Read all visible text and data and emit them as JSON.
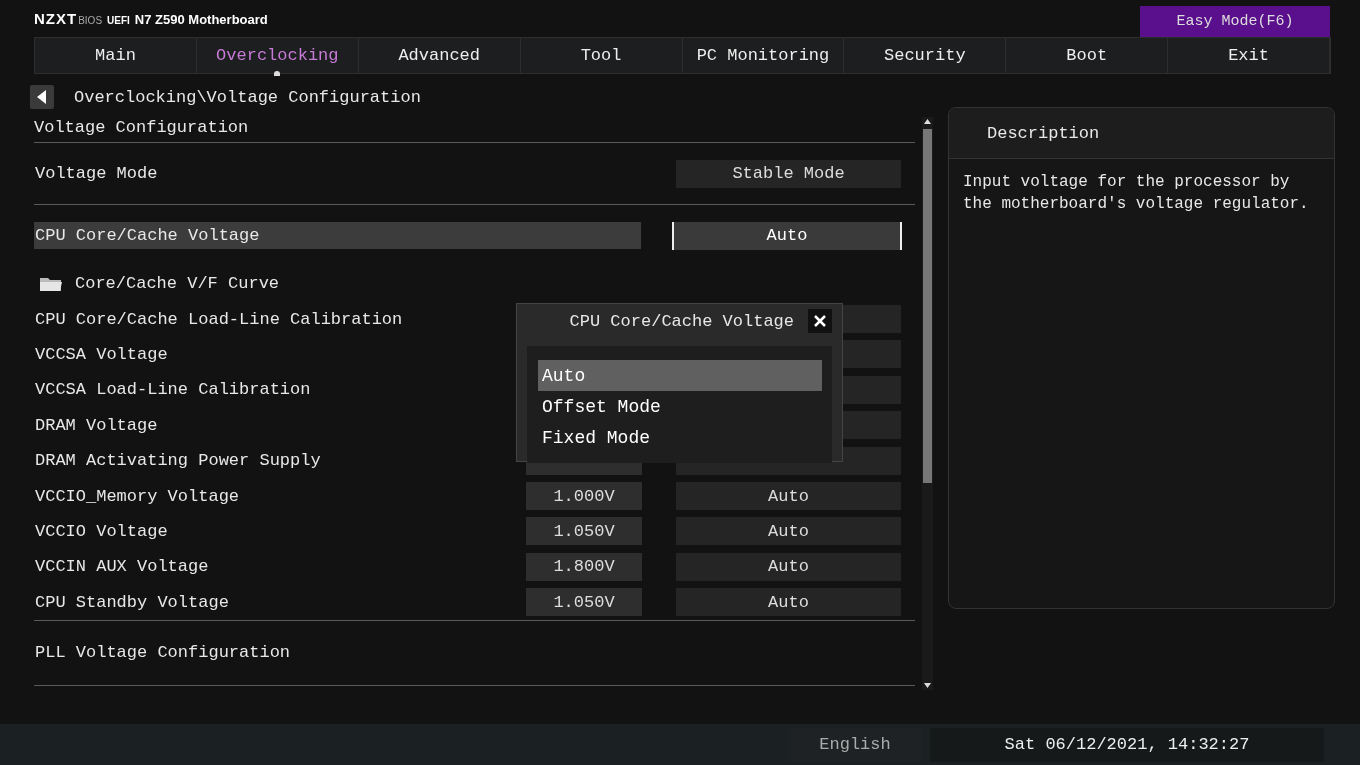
{
  "header": {
    "brand": "NZXT",
    "bios": "BIOS",
    "uefi": "UEFI",
    "model": "N7 Z590 Motherboard",
    "easy_mode": "Easy Mode(F6)"
  },
  "tabs": [
    {
      "label": "Main",
      "selected": false
    },
    {
      "label": "Overclocking",
      "selected": true
    },
    {
      "label": "Advanced",
      "selected": false
    },
    {
      "label": "Tool",
      "selected": false
    },
    {
      "label": "PC Monitoring",
      "selected": false
    },
    {
      "label": "Security",
      "selected": false
    },
    {
      "label": "Boot",
      "selected": false
    },
    {
      "label": "Exit",
      "selected": false
    }
  ],
  "breadcrumb": "Overclocking\\Voltage Configuration",
  "page_title": "Voltage Configuration",
  "settings": [
    {
      "kind": "option",
      "label": "Voltage Mode",
      "value": "Stable Mode",
      "selected": false
    },
    {
      "kind": "option",
      "label": "CPU Core/Cache Voltage",
      "value": "Auto",
      "selected": true
    },
    {
      "kind": "folder",
      "label": "Core/Cache V/F Curve",
      "selected": false
    },
    {
      "kind": "covered",
      "label": "CPU Core/Cache Load-Line Calibration",
      "selected": false
    },
    {
      "kind": "covered",
      "label": "VCCSA Voltage",
      "selected": false
    },
    {
      "kind": "covered",
      "label": "VCCSA Load-Line Calibration",
      "selected": false
    },
    {
      "kind": "covered",
      "label": "DRAM Voltage",
      "selected": false
    },
    {
      "kind": "half_covered",
      "label": "DRAM Activating Power Supply",
      "selected": false
    },
    {
      "kind": "voltage",
      "label": "VCCIO_Memory Voltage",
      "reading": "1.000V",
      "value": "Auto",
      "selected": false
    },
    {
      "kind": "voltage",
      "label": "VCCIO Voltage",
      "reading": "1.050V",
      "value": "Auto",
      "selected": false
    },
    {
      "kind": "voltage",
      "label": "VCCIN AUX Voltage",
      "reading": "1.800V",
      "value": "Auto",
      "selected": false
    },
    {
      "kind": "voltage",
      "label": "CPU Standby Voltage",
      "reading": "1.050V",
      "value": "Auto",
      "selected": false
    },
    {
      "kind": "section",
      "label": "PLL Voltage Configuration",
      "selected": false
    }
  ],
  "popup": {
    "title": "CPU Core/Cache Voltage",
    "options": [
      {
        "label": "Auto",
        "selected": true
      },
      {
        "label": "Offset Mode",
        "selected": false
      },
      {
        "label": "Fixed Mode",
        "selected": false
      }
    ]
  },
  "description": {
    "title": "Description",
    "text": "Input voltage for the processor by the motherboard's voltage regulator."
  },
  "status_bar": {
    "language": "English",
    "datetime": "Sat 06/12/2021, 14:32:27"
  }
}
